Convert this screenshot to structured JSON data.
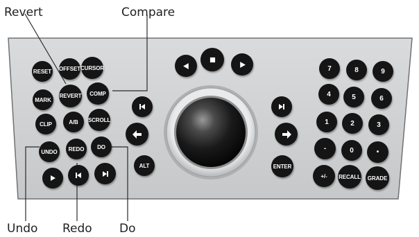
{
  "callouts": {
    "revert": "Revert",
    "compare": "Compare",
    "undo": "Undo",
    "redo": "Redo",
    "do": "Do"
  },
  "keys": {
    "reset": "RESET",
    "offset": "OFFSET",
    "cursor": "CURSOR",
    "mark": "MARK",
    "revert": "REVERT",
    "comp": "COMP",
    "clip": "CLIP",
    "ab": "A/B",
    "scroll": "SCROLL",
    "undo": "UNDO",
    "redo": "REDO",
    "do": "DO",
    "alt": "ALT",
    "enter": "ENTER",
    "plus_minus": "+/-",
    "recall": "RECALL",
    "grade": "GRADE",
    "minus": "-",
    "dot": "•",
    "digits": [
      "7",
      "8",
      "9",
      "4",
      "5",
      "6",
      "1",
      "2",
      "3",
      "0"
    ]
  },
  "icons": {
    "transport_left": "play-left-icon",
    "transport_stop": "stop-icon",
    "transport_right": "play-right-icon",
    "prev": "skip-previous-icon",
    "next": "skip-next-icon",
    "arrow_left": "arrow-left-icon",
    "arrow_right": "arrow-right-icon",
    "play": "play-icon"
  },
  "colors": {
    "panel": "#d0d2d3",
    "panel_edge": "#6f7173",
    "key": "#151515",
    "key_text": "#ffffff",
    "leader_line": "#2a2a2a"
  }
}
